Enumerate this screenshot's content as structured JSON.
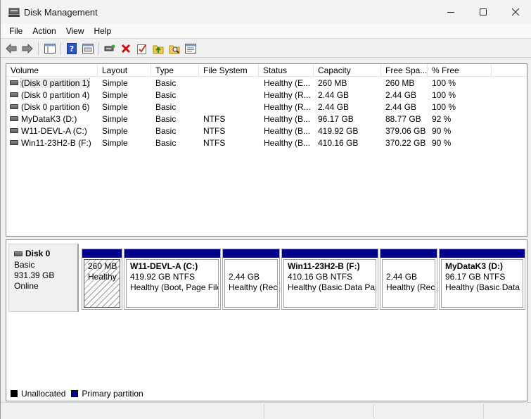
{
  "window": {
    "title": "Disk Management"
  },
  "menu": [
    "File",
    "Action",
    "View",
    "Help"
  ],
  "toolbar": {
    "icons": [
      "back-arrow-icon",
      "forward-arrow-icon",
      "console-tree-icon",
      "help-icon",
      "detail-view-icon",
      "connect-disk-icon",
      "delete-icon",
      "check-icon",
      "folder-up-icon",
      "folder-search-icon",
      "properties-icon"
    ]
  },
  "volume_list": {
    "columns": [
      "Volume",
      "Layout",
      "Type",
      "File System",
      "Status",
      "Capacity",
      "Free Spa...",
      "% Free"
    ],
    "rows": [
      {
        "volume": "(Disk 0 partition 1)",
        "layout": "Simple",
        "type": "Basic",
        "fs": "",
        "status": "Healthy (E...",
        "capacity": "260 MB",
        "free": "260 MB",
        "pct": "100 %"
      },
      {
        "volume": "(Disk 0 partition 4)",
        "layout": "Simple",
        "type": "Basic",
        "fs": "",
        "status": "Healthy (R...",
        "capacity": "2.44 GB",
        "free": "2.44 GB",
        "pct": "100 %"
      },
      {
        "volume": "(Disk 0 partition 6)",
        "layout": "Simple",
        "type": "Basic",
        "fs": "",
        "status": "Healthy (R...",
        "capacity": "2.44 GB",
        "free": "2.44 GB",
        "pct": "100 %"
      },
      {
        "volume": "MyDataK3 (D:)",
        "layout": "Simple",
        "type": "Basic",
        "fs": "NTFS",
        "status": "Healthy (B...",
        "capacity": "96.17 GB",
        "free": "88.77 GB",
        "pct": "92 %"
      },
      {
        "volume": "W11-DEVL-A (C:)",
        "layout": "Simple",
        "type": "Basic",
        "fs": "NTFS",
        "status": "Healthy (B...",
        "capacity": "419.92 GB",
        "free": "379.06 GB",
        "pct": "90 %"
      },
      {
        "volume": "Win11-23H2-B (F:)",
        "layout": "Simple",
        "type": "Basic",
        "fs": "NTFS",
        "status": "Healthy (B...",
        "capacity": "410.16 GB",
        "free": "370.22 GB",
        "pct": "90 %"
      }
    ]
  },
  "disk": {
    "name": "Disk 0",
    "type": "Basic",
    "size": "931.39 GB",
    "state": "Online",
    "partitions": [
      {
        "name": "",
        "size": "260 MB",
        "status": "Healthy",
        "hatched": true
      },
      {
        "name": "W11-DEVL-A  (C:)",
        "size": "419.92 GB NTFS",
        "status": "Healthy (Boot, Page File"
      },
      {
        "name": "",
        "size": "2.44 GB",
        "status": "Healthy (Rec"
      },
      {
        "name": "Win11-23H2-B  (F:)",
        "size": "410.16 GB NTFS",
        "status": "Healthy (Basic Data Part"
      },
      {
        "name": "",
        "size": "2.44 GB",
        "status": "Healthy (Rec"
      },
      {
        "name": "MyDataK3  (D:)",
        "size": "96.17 GB NTFS",
        "status": "Healthy (Basic Data P"
      }
    ]
  },
  "legend": [
    {
      "label": "Unallocated",
      "color": "#000000"
    },
    {
      "label": "Primary partition",
      "color": "#00008b"
    }
  ],
  "colors": {
    "primary": "#00008b",
    "unallocated": "#000000"
  }
}
